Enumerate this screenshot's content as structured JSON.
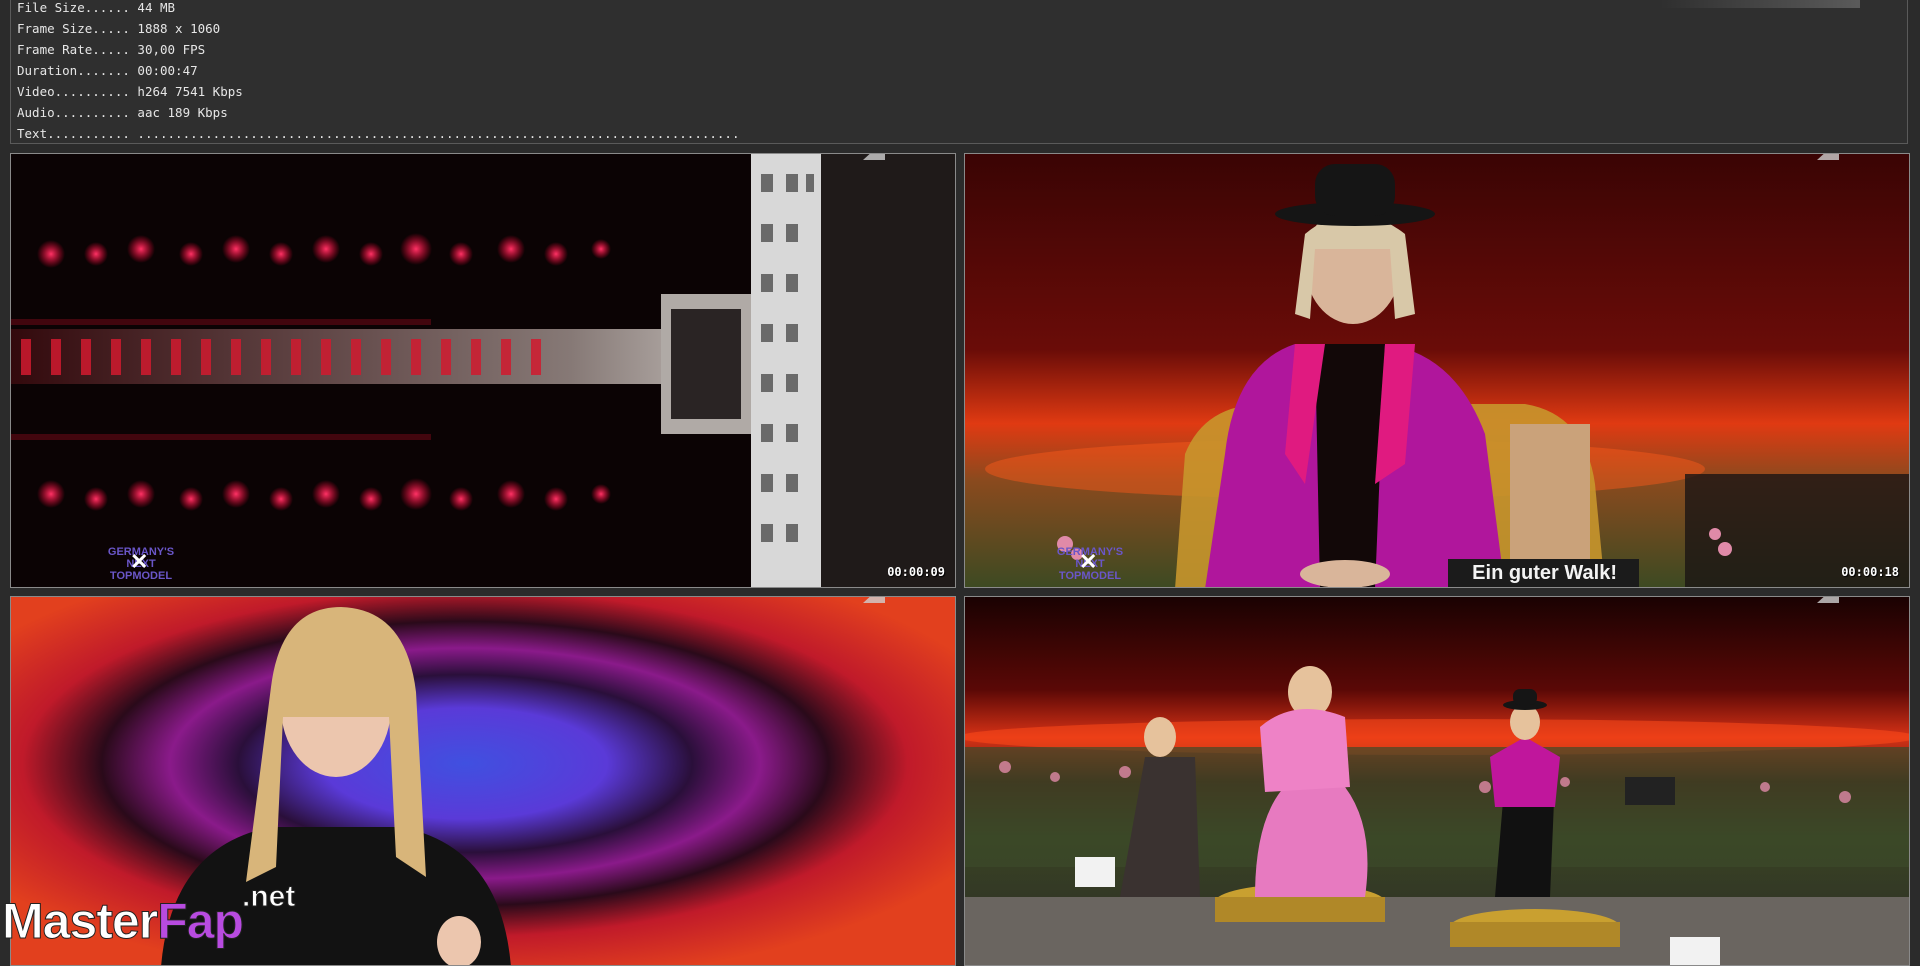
{
  "info": {
    "lines": [
      {
        "key": "File Size......",
        "value": "44 MB"
      },
      {
        "key": "Frame Size.....",
        "value": "1888 x 1060"
      },
      {
        "key": "Frame Rate.....",
        "value": "30,00 FPS"
      },
      {
        "key": "Duration.......",
        "value": "00:00:47"
      },
      {
        "key": "Video..........",
        "value": "h264 7541 Kbps"
      },
      {
        "key": "Audio..........",
        "value": "aac 189 Kbps"
      },
      {
        "key": "Text...........",
        "value": "................................................................................"
      }
    ]
  },
  "frames": [
    {
      "timestamp": "00:00:09",
      "logo": "GERMANY'S NEXT TOPMODEL",
      "logo_mark": "✕"
    },
    {
      "timestamp": "00:00:18",
      "logo": "GERMANY'S NEXT TOPMODEL",
      "logo_mark": "✕",
      "caption": "Ein guter Walk!"
    },
    {
      "timestamp": ""
    },
    {
      "timestamp": ""
    }
  ],
  "watermark": {
    "part1": "Master",
    "part2": "Fap",
    "suffix": ".net"
  },
  "colors": {
    "accent_pink": "#c8209a",
    "watermark_purple": "#b84be0",
    "logo_purple": "#6a56c8"
  }
}
